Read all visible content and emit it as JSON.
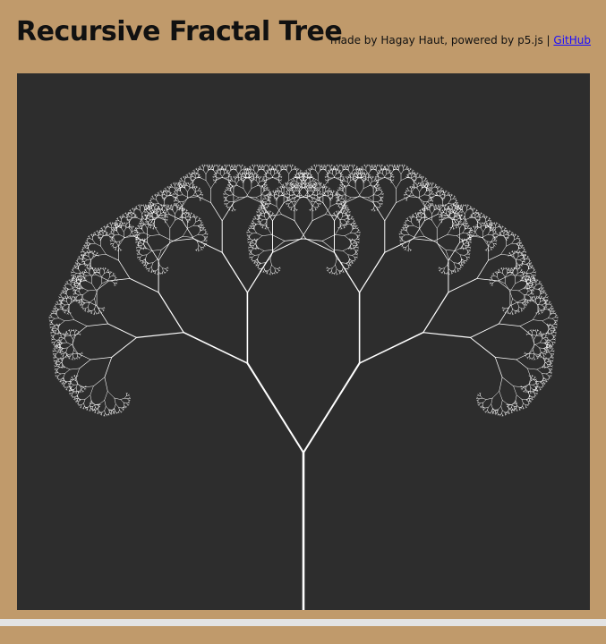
{
  "header": {
    "title": "Recursive Fractal Tree",
    "credits_text": "made by Hagay Haut, powered by p5.js | ",
    "github_link": "GitHub"
  },
  "canvas": {
    "background": "#2d2d2d",
    "branch_color": "#ffffff"
  },
  "colors": {
    "page_background": "#c09a6b",
    "link": "#1a0dff",
    "bottom_bar": "#e3e3e3"
  }
}
